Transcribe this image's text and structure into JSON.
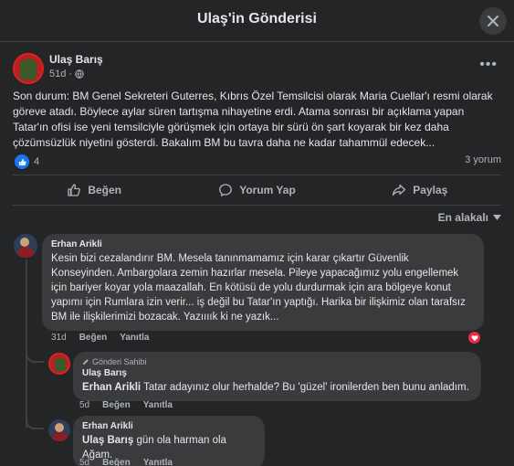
{
  "dialog": {
    "title": "Ulaş'in Gönderisi"
  },
  "post": {
    "author": "Ulaş Barış",
    "time": "51d",
    "text": "Son durum: BM Genel Sekreteri Guterres, Kıbrıs Özel Temsilcisi olarak Maria Cuellar'ı resmi olarak göreve atadı. Böylece aylar süren tartışma nihayetine erdi. Atama sonrası bir açıklama yapan Tatar'ın ofisi ise yeni temsilciyle görüşmek için ortaya bir sürü ön şart koyarak bir kez daha çözümsüzlük niyetini gösterdi. Bakalım BM bu tavra daha ne kadar tahammül edecek...",
    "reaction_count": "4",
    "comment_count": "3 yorum"
  },
  "actions": {
    "like": "Beğen",
    "comment": "Yorum Yap",
    "share": "Paylaş"
  },
  "sort": {
    "label": "En alakalı"
  },
  "comments": [
    {
      "name": "Erhan Arikli",
      "text": "Kesin bizi cezalandırır BM. Mesela tanınmamamız için karar çıkartır Güvenlik Konseyinden. Ambargolara zemin hazırlar mesela. Pileye yapacağımız yolu engellemek için bariyer koyar yola maazallah. En kötüsü de yolu durdurmak için ara bölgeye konut yapımı için Rumlara izin verir... iş değil bu Tatar'ın yaptığı. Harika bir ilişkimiz olan tarafsız BM ile ilişkilerimizi bozacak. Yazıııık ki ne yazık...",
      "time": "31d",
      "like": "Beğen",
      "reply": "Yanıtla"
    }
  ],
  "replies": [
    {
      "badge": "Gönderi Sahibi",
      "name": "Ulaş Barış",
      "mention": "Erhan Arikli",
      "text": " Tatar adayınız olur herhalde? Bu 'güzel' ironilerden ben bunu anladım.",
      "time": "5d",
      "like": "Beğen",
      "reply": "Yanıtla"
    },
    {
      "name": "Erhan Arikli",
      "mention": "Ulaş Barış",
      "text": " gün ola harman ola Ağam.",
      "time": "5d",
      "like": "Beğen",
      "reply": "Yanıtla"
    }
  ],
  "colors": {
    "background": "#242526",
    "bubble": "#3a3b3c",
    "like_blue": "#1877f2",
    "heart_red": "#f02849",
    "text": "#e4e6eb",
    "secondary_text": "#b0b3b8"
  }
}
